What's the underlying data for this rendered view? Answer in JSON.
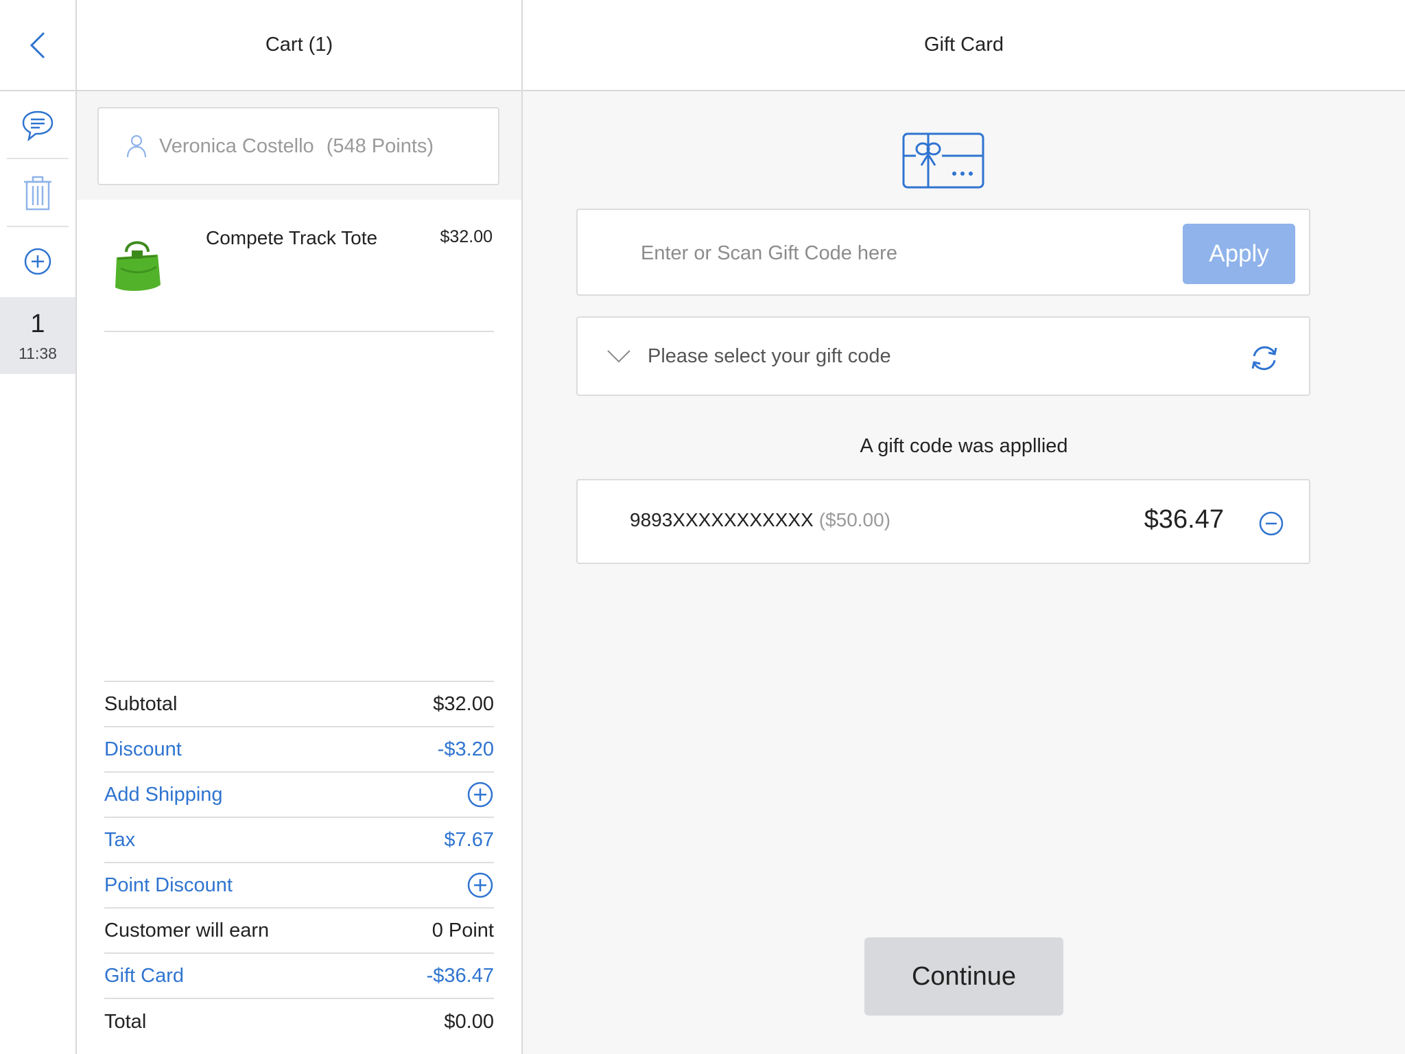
{
  "rail": {
    "order_number": "1",
    "order_time": "11:38"
  },
  "cart": {
    "title": "Cart (1)",
    "customer": {
      "name": "Veronica Costello",
      "points": "(548 Points)"
    },
    "items": [
      {
        "name": "Compete Track Tote",
        "price": "$32.00"
      }
    ],
    "totals": {
      "subtotal_label": "Subtotal",
      "subtotal_value": "$32.00",
      "discount_label": "Discount",
      "discount_value": "-$3.20",
      "shipping_label": "Add Shipping",
      "tax_label": "Tax",
      "tax_value": "$7.67",
      "point_discount_label": "Point Discount",
      "earn_label": "Customer will earn",
      "earn_value": "0 Point",
      "giftcard_label": "Gift Card",
      "giftcard_value": "-$36.47",
      "total_label": "Total",
      "total_value": "$0.00"
    }
  },
  "gift": {
    "title": "Gift Card",
    "input_placeholder": "Enter or Scan Gift Code here",
    "apply_label": "Apply",
    "select_label": "Please select your gift code",
    "applied_title": "A gift code was appllied",
    "applied_code": "9893XXXXXXXXXXX",
    "applied_original": "($50.00)",
    "applied_amount": "$36.47",
    "continue_label": "Continue"
  },
  "colors": {
    "accent": "#2f74d0",
    "apply_button": "#8fb3ea",
    "continue_button": "#d8d9dc"
  },
  "icons": [
    "back-chevron-icon",
    "comment-icon",
    "trash-icon",
    "add-circle-icon",
    "user-icon",
    "gift-card-icon",
    "chevron-down-icon",
    "refresh-icon",
    "remove-circle-icon",
    "plus-circle-icon"
  ]
}
